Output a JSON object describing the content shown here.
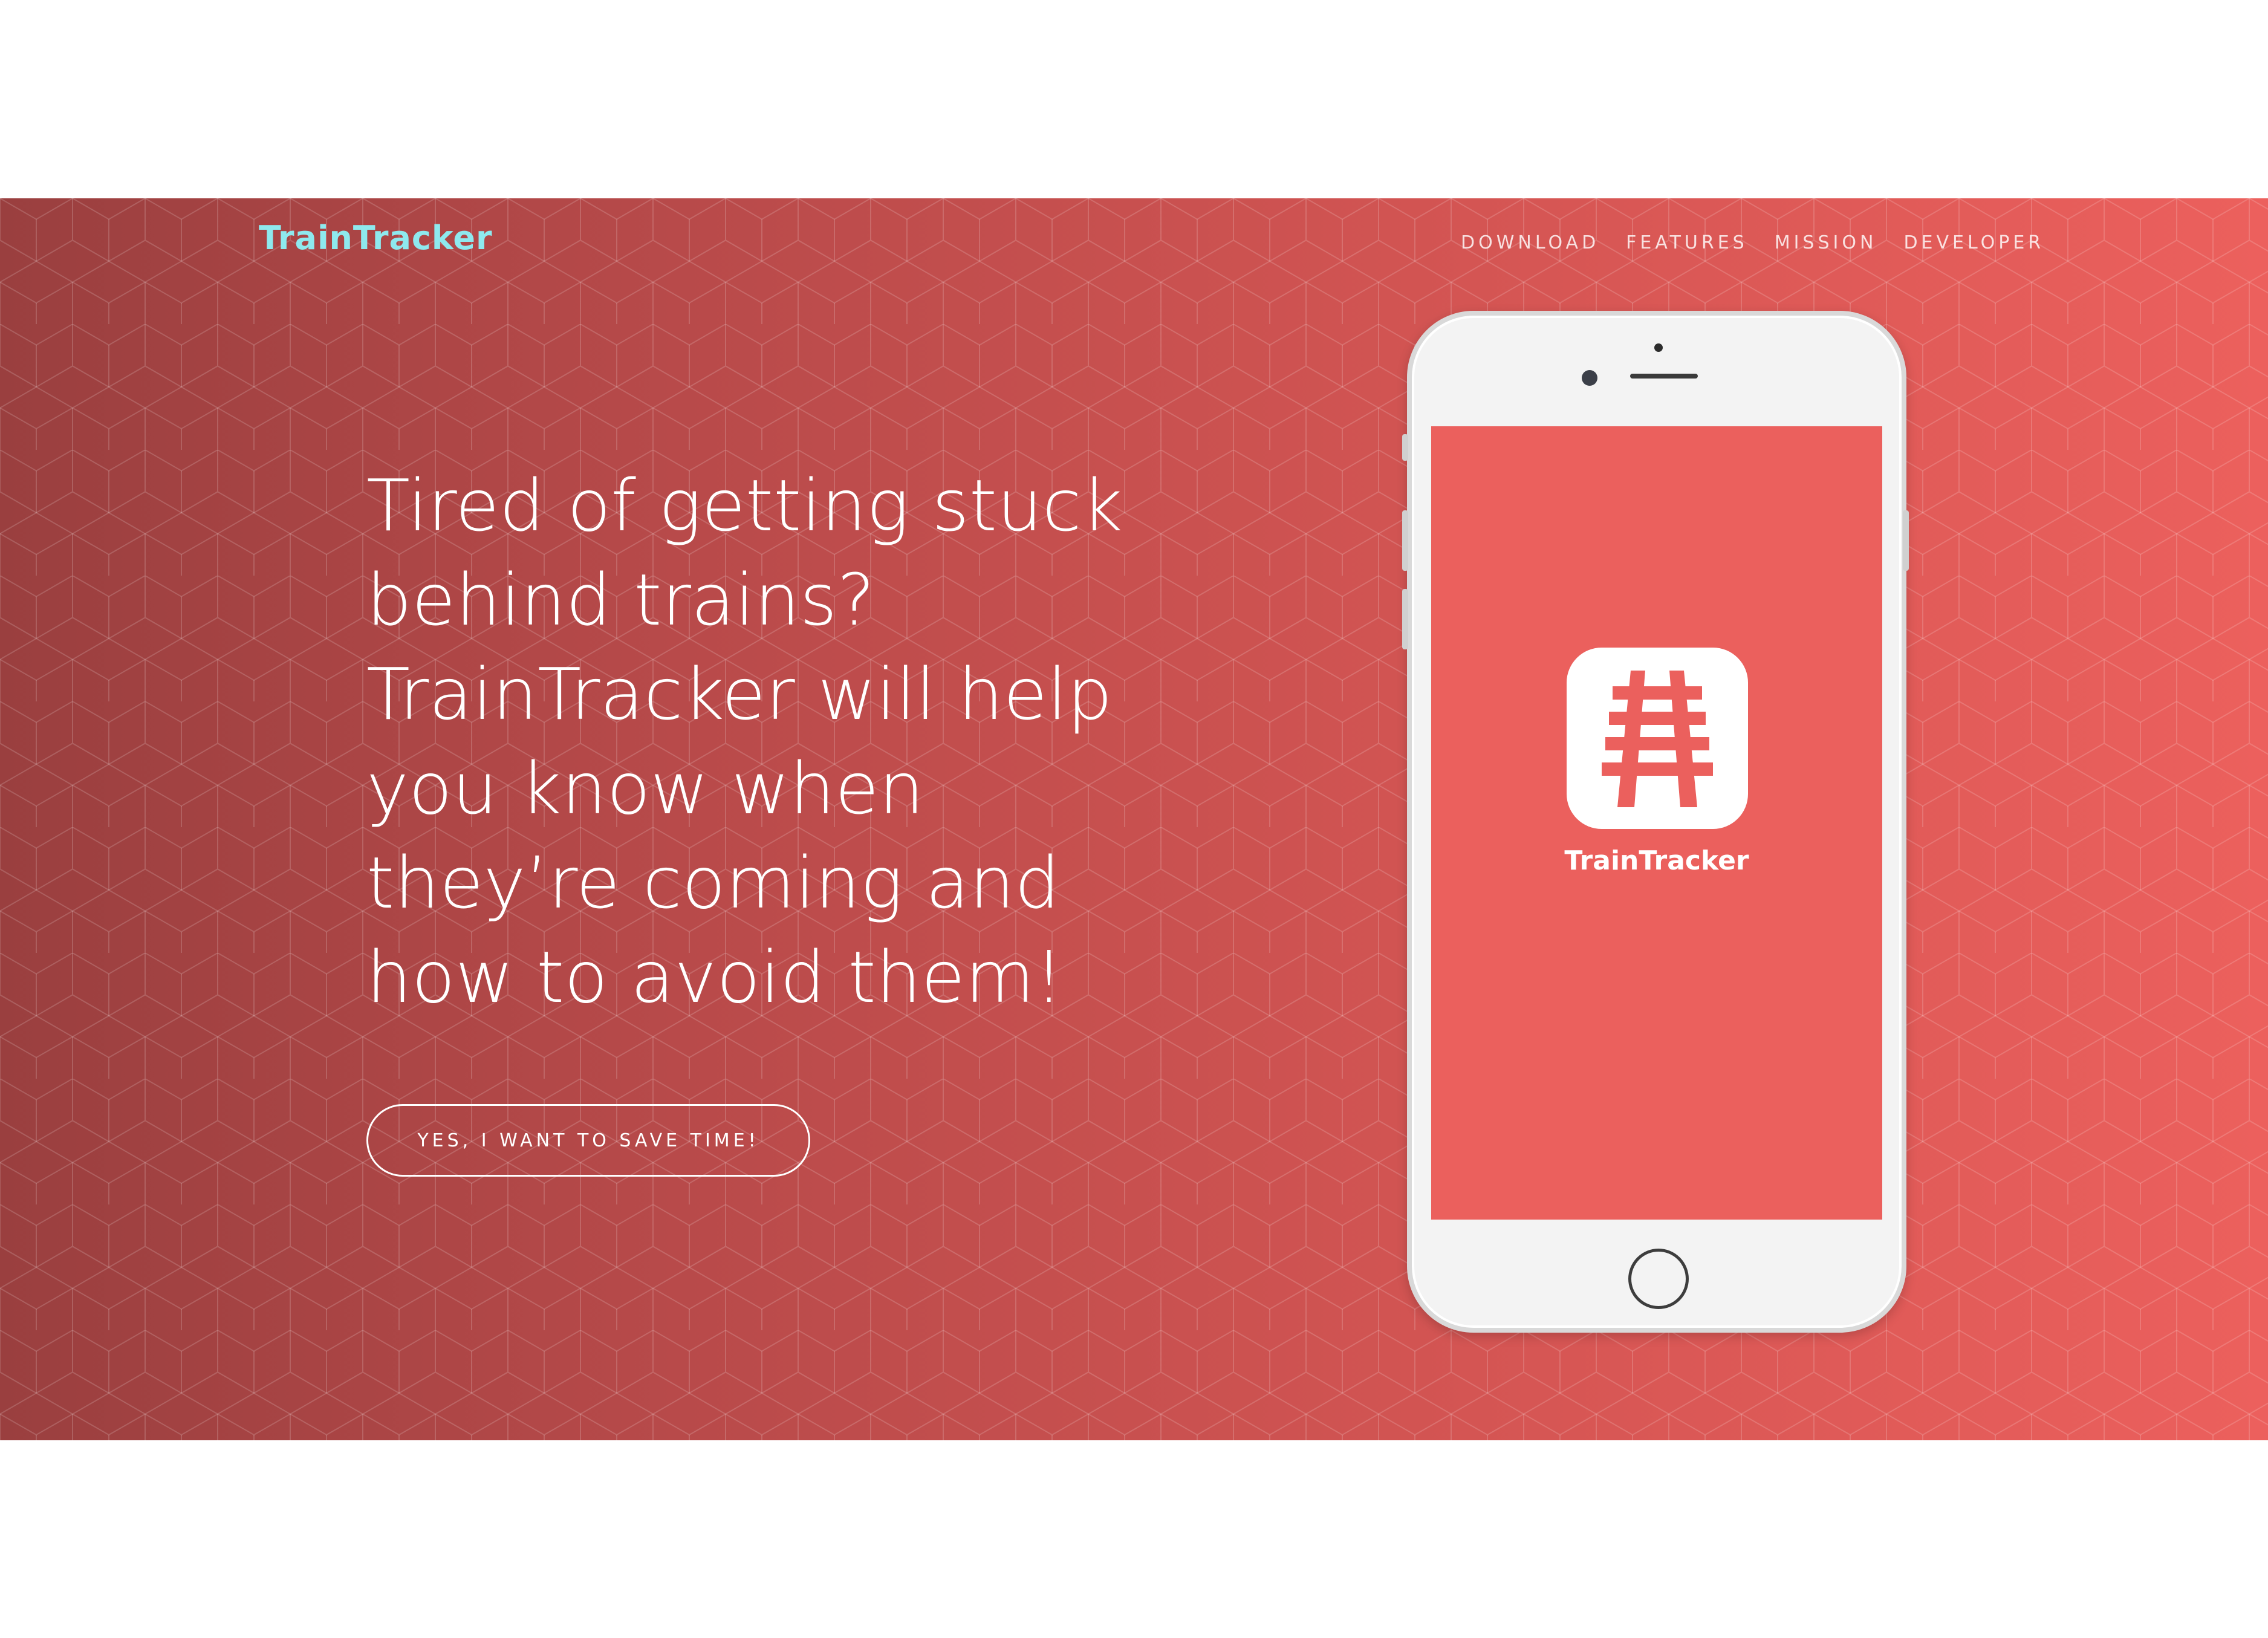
{
  "brand": {
    "logo_text": "TrainTracker",
    "logo_color": "#8ee9ee"
  },
  "nav": {
    "items": [
      {
        "label": "DOWNLOAD"
      },
      {
        "label": "FEATURES"
      },
      {
        "label": "MISSION"
      },
      {
        "label": "DEVELOPER"
      }
    ]
  },
  "hero": {
    "headline": "Tired of getting stuck behind trains? TrainTracker will help you know when they’re coming and how to avoid them!",
    "cta_label": "YES, I WANT TO SAVE TIME!",
    "gradient_start": "#9a3f3f",
    "gradient_end": "#ec605d"
  },
  "phone": {
    "screen_color": "#eb605d",
    "app_name": "TrainTracker",
    "app_icon": "railroad-tracks-icon"
  }
}
